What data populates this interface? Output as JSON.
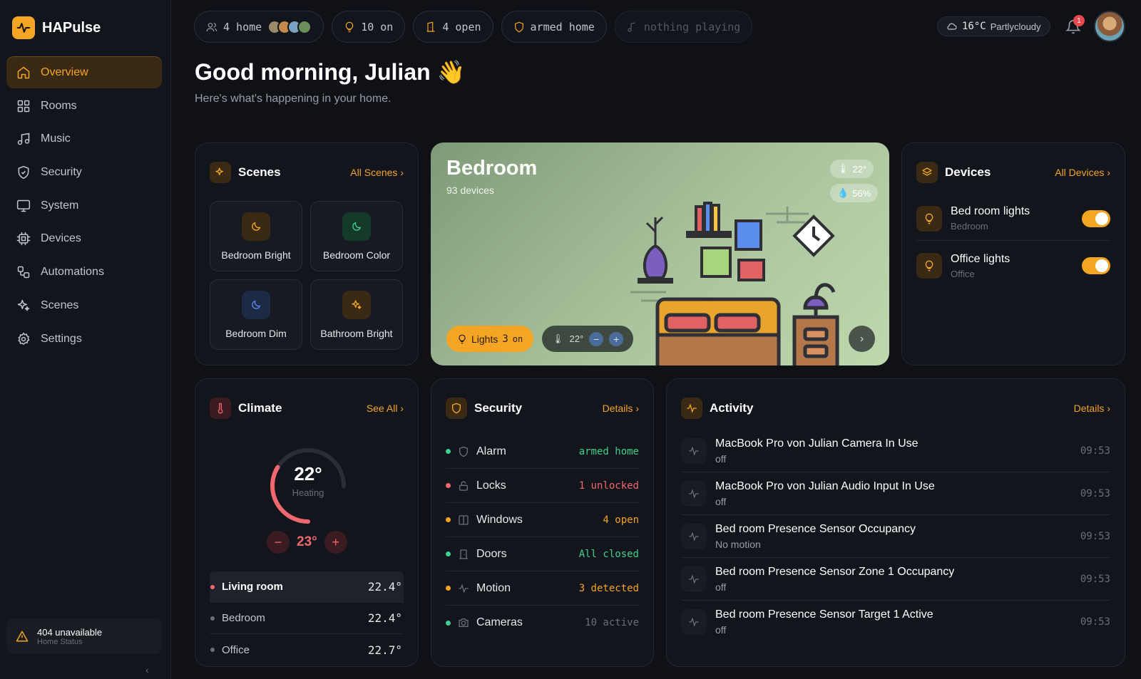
{
  "app": {
    "name": "HAPulse"
  },
  "sidebar": {
    "items": [
      {
        "label": "Overview",
        "icon": "home-icon"
      },
      {
        "label": "Rooms",
        "icon": "grid-icon"
      },
      {
        "label": "Music",
        "icon": "music-icon"
      },
      {
        "label": "Security",
        "icon": "shield-icon"
      },
      {
        "label": "System",
        "icon": "monitor-icon"
      },
      {
        "label": "Devices",
        "icon": "chip-icon"
      },
      {
        "label": "Automations",
        "icon": "workflow-icon"
      },
      {
        "label": "Scenes",
        "icon": "sparkles-icon"
      },
      {
        "label": "Settings",
        "icon": "gear-icon"
      }
    ],
    "status": {
      "main": "404 unavailable",
      "sub": "Home Status"
    },
    "collapse": "‹"
  },
  "topbar": {
    "people": "4 home",
    "lights": "10 on",
    "openings": "4 open",
    "alarm": "armed home",
    "music": "nothing playing"
  },
  "weather": {
    "temp": "16°C",
    "condition": "Partlycloudy"
  },
  "notifications": {
    "count": "1"
  },
  "greeting": {
    "title": "Good morning, Julian 👋",
    "subtitle": "Here's what's happening in your home."
  },
  "scenes": {
    "title": "Scenes",
    "link": "All Scenes",
    "items": [
      {
        "label": "Bedroom Bright",
        "color": "#f5a524"
      },
      {
        "label": "Bedroom Color",
        "color": "#3fcf8e"
      },
      {
        "label": "Bedroom Dim",
        "color": "#5b8def"
      },
      {
        "label": "Bathroom Bright",
        "color": "#f5a524"
      }
    ]
  },
  "bedroom": {
    "title": "Bedroom",
    "devices": "93 devices",
    "temp": "22°",
    "humidity": "56%",
    "lights_label": "Lights",
    "lights_count": "3",
    "lights_state": "on",
    "set_temp": "22°",
    "minus": "−",
    "plus": "+",
    "next": "›"
  },
  "devices": {
    "title": "Devices",
    "link": "All Devices",
    "items": [
      {
        "name": "Bed room lights",
        "room": "Bedroom",
        "on": true
      },
      {
        "name": "Office lights",
        "room": "Office",
        "on": true
      }
    ]
  },
  "climate": {
    "title": "Climate",
    "link": "See All",
    "current": "22°",
    "mode": "Heating",
    "target": "23°",
    "minus": "−",
    "plus": "+",
    "heating_level": 0.45,
    "rooms": [
      {
        "name": "Living room",
        "value": "22.4°"
      },
      {
        "name": "Bedroom",
        "value": "22.4°"
      },
      {
        "name": "Office",
        "value": "22.7°"
      }
    ]
  },
  "security": {
    "title": "Security",
    "link": "Details",
    "items": [
      {
        "name": "Alarm",
        "value": "armed home",
        "dot": "#3fcf8e",
        "color": "#3fcf8e"
      },
      {
        "name": "Locks",
        "value": "1 unlocked",
        "dot": "#f0676e",
        "color": "#f0676e"
      },
      {
        "name": "Windows",
        "value": "4 open",
        "dot": "#f5a524",
        "color": "#f5a524"
      },
      {
        "name": "Doors",
        "value": "All closed",
        "dot": "#3fcf8e",
        "color": "#3fcf8e"
      },
      {
        "name": "Motion",
        "value": "3 detected",
        "dot": "#f5a524",
        "color": "#f5a524"
      },
      {
        "name": "Cameras",
        "value": "10 active",
        "dot": "#3fcf8e",
        "color": "#6b6e78"
      }
    ]
  },
  "activity": {
    "title": "Activity",
    "link": "Details",
    "items": [
      {
        "title": "MacBook Pro von Julian Camera In Use",
        "sub": "off",
        "time": "09:53"
      },
      {
        "title": "MacBook Pro von Julian Audio Input In Use",
        "sub": "off",
        "time": "09:53"
      },
      {
        "title": "Bed room Presence Sensor Occupancy",
        "sub": "No motion",
        "time": "09:53"
      },
      {
        "title": "Bed room Presence Sensor Zone 1 Occupancy",
        "sub": "off",
        "time": "09:53"
      },
      {
        "title": "Bed room Presence Sensor Target 1 Active",
        "sub": "off",
        "time": "09:53"
      }
    ]
  },
  "colors": {
    "accent": "#f5a524",
    "danger": "#f0676e",
    "success": "#3fcf8e"
  }
}
